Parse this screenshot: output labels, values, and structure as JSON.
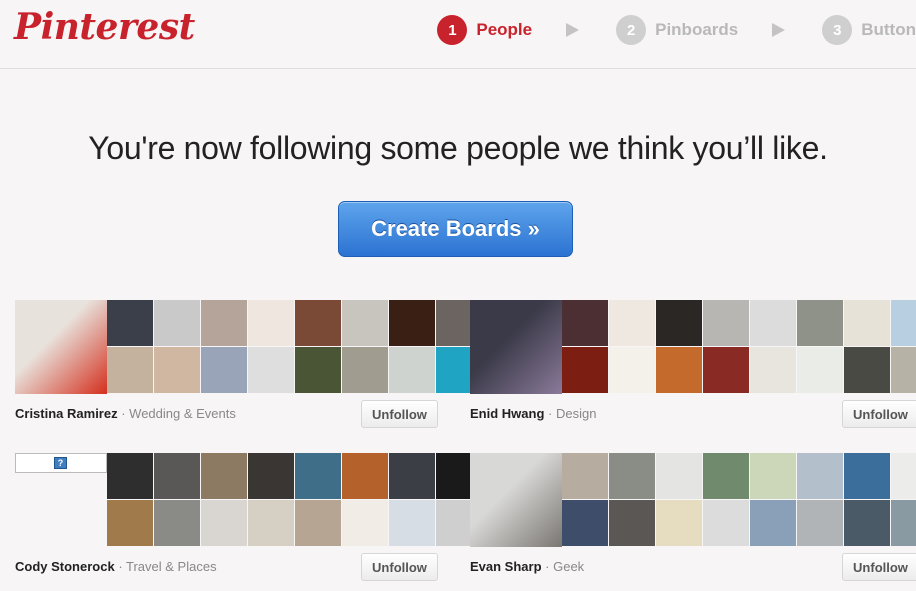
{
  "app": {
    "logo": "Pinterest"
  },
  "steps": [
    {
      "num": "1",
      "label": "People",
      "active": true
    },
    {
      "num": "2",
      "label": "Pinboards",
      "active": false
    },
    {
      "num": "3",
      "label": "Button",
      "active": false
    }
  ],
  "headline": "You're now following some people we think you’ll like.",
  "cta": {
    "label": "Create Boards »"
  },
  "cards": [
    {
      "name": "Cristina Ramirez",
      "category": "· Wedding & Events",
      "button": "Unfollow",
      "avatar": [
        "#e8e2dc",
        "#d42f1d"
      ],
      "thumbs": [
        "#3b3f4a",
        "#c9c9c9",
        "#b4a49a",
        "#f0e6e0",
        "#7b4a36",
        "#c8c4be",
        "#3a1f14",
        "#6b6460",
        "#c4b29e",
        "#cfb7a2",
        "#99a4b8",
        "#dedede",
        "#495535",
        "#a09c90",
        "#cfd3cf",
        "#1fa4c4"
      ]
    },
    {
      "name": "Enid Hwang",
      "category": "· Design",
      "button": "Unfollow",
      "avatar": [
        "#3a3a48",
        "#8a7a9a"
      ],
      "thumbs": [
        "#4c2f33",
        "#efe8e0",
        "#2a2724",
        "#b8b6b2",
        "#dcdcdc",
        "#8e9288",
        "#e7e2d8",
        "#b7cfe0",
        "#7d1e12",
        "#f4f1ea",
        "#c46a2c",
        "#8a2a24",
        "#e8e4de",
        "#e9ece7",
        "#4a4a44",
        "#b6b2a6"
      ]
    },
    {
      "name": "Cody Stonerock",
      "category": "· Travel & Places",
      "button": "Unfollow",
      "avatar": [
        "#f7f5f5",
        "#f7f5f5"
      ],
      "thumbs": [
        "#2e2e2e",
        "#5a5856",
        "#8c7a62",
        "#3a3634",
        "#3f6e88",
        "#b5612c",
        "#3b3e44",
        "#1a1a1a",
        "#a07a4a",
        "#8a8a86",
        "#d9d6d2",
        "#d6cfc4",
        "#b6a592",
        "#f1ede6",
        "#d7dde4",
        "#cfcfcf"
      ]
    },
    {
      "name": "Evan Sharp",
      "category": "· Geek",
      "button": "Unfollow",
      "avatar": [
        "#d8d8d6",
        "#7a7672"
      ],
      "thumbs": [
        "#b6ada0",
        "#8a8c86",
        "#e4e4e2",
        "#6f8a6c",
        "#ccd6b8",
        "#b3c0cc",
        "#3b6e9a",
        "#ececea",
        "#3e4e6a",
        "#5b5754",
        "#e6dcc0",
        "#dcdcdc",
        "#8aa0b8",
        "#b0b4b6",
        "#4a5a66",
        "#8a9aa2"
      ]
    },
    {
      "broken_image": "?"
    }
  ]
}
